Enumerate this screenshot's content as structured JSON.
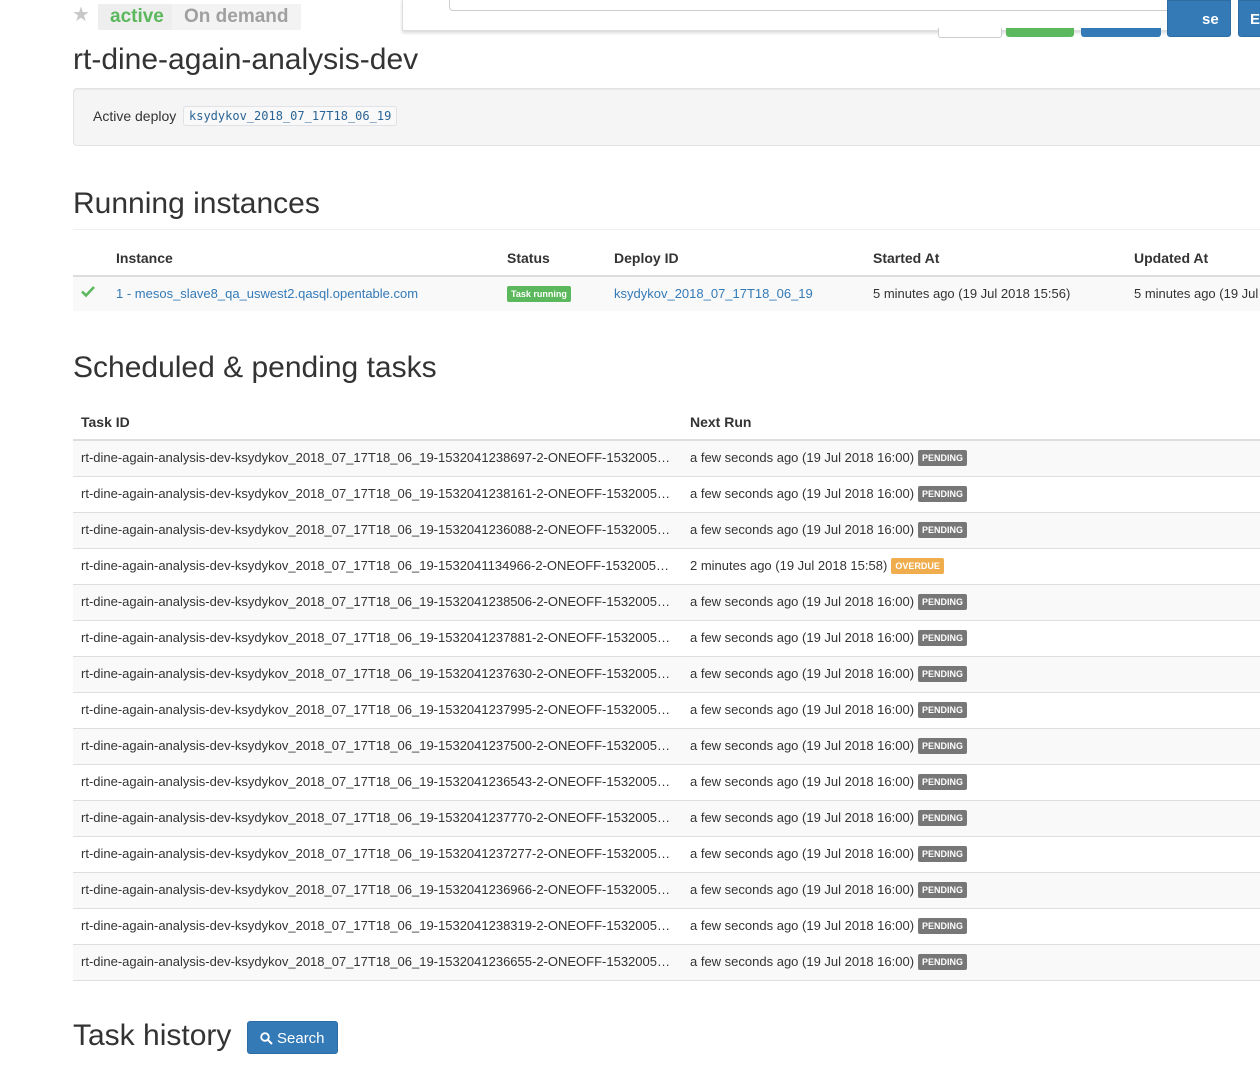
{
  "header": {
    "favorite_icon": "star-icon",
    "state_label": "active",
    "type_label": "On demand",
    "top_buttons": [
      "se",
      "E"
    ]
  },
  "page_title": "rt-dine-again-analysis-dev",
  "active_deploy": {
    "label": "Active deploy",
    "deploy_id": "ksydykov_2018_07_17T18_06_19"
  },
  "running_instances": {
    "title": "Running instances",
    "columns": [
      "Instance",
      "Status",
      "Deploy ID",
      "Started At",
      "Updated At"
    ],
    "rows": [
      {
        "health_icon": "check-icon",
        "instance": "1 - mesos_slave8_qa_uswest2.qasql.opentable.com",
        "status": "Task running",
        "deploy_id": "ksydykov_2018_07_17T18_06_19",
        "started_at": "5 minutes ago (19 Jul 2018 15:56)",
        "updated_at": "5 minutes ago (19 Jul"
      }
    ]
  },
  "scheduled_tasks": {
    "title": "Scheduled & pending tasks",
    "columns": [
      "Task ID",
      "Next Run"
    ],
    "rows": [
      {
        "task_id": "rt-dine-again-analysis-dev-ksydykov_2018_07_17T18_06_19-1532041238697-2-ONEOFF-1532005…",
        "next_run": "a few seconds ago (19 Jul 2018 16:00)",
        "state": "PENDING"
      },
      {
        "task_id": "rt-dine-again-analysis-dev-ksydykov_2018_07_17T18_06_19-1532041238161-2-ONEOFF-1532005…",
        "next_run": "a few seconds ago (19 Jul 2018 16:00)",
        "state": "PENDING"
      },
      {
        "task_id": "rt-dine-again-analysis-dev-ksydykov_2018_07_17T18_06_19-1532041236088-2-ONEOFF-1532005…",
        "next_run": "a few seconds ago (19 Jul 2018 16:00)",
        "state": "PENDING"
      },
      {
        "task_id": "rt-dine-again-analysis-dev-ksydykov_2018_07_17T18_06_19-1532041134966-2-ONEOFF-1532005…",
        "next_run": "2 minutes ago (19 Jul 2018 15:58)",
        "state": "OVERDUE"
      },
      {
        "task_id": "rt-dine-again-analysis-dev-ksydykov_2018_07_17T18_06_19-1532041238506-2-ONEOFF-1532005…",
        "next_run": "a few seconds ago (19 Jul 2018 16:00)",
        "state": "PENDING"
      },
      {
        "task_id": "rt-dine-again-analysis-dev-ksydykov_2018_07_17T18_06_19-1532041237881-2-ONEOFF-1532005…",
        "next_run": "a few seconds ago (19 Jul 2018 16:00)",
        "state": "PENDING"
      },
      {
        "task_id": "rt-dine-again-analysis-dev-ksydykov_2018_07_17T18_06_19-1532041237630-2-ONEOFF-1532005…",
        "next_run": "a few seconds ago (19 Jul 2018 16:00)",
        "state": "PENDING"
      },
      {
        "task_id": "rt-dine-again-analysis-dev-ksydykov_2018_07_17T18_06_19-1532041237995-2-ONEOFF-1532005…",
        "next_run": "a few seconds ago (19 Jul 2018 16:00)",
        "state": "PENDING"
      },
      {
        "task_id": "rt-dine-again-analysis-dev-ksydykov_2018_07_17T18_06_19-1532041237500-2-ONEOFF-1532005…",
        "next_run": "a few seconds ago (19 Jul 2018 16:00)",
        "state": "PENDING"
      },
      {
        "task_id": "rt-dine-again-analysis-dev-ksydykov_2018_07_17T18_06_19-1532041236543-2-ONEOFF-1532005…",
        "next_run": "a few seconds ago (19 Jul 2018 16:00)",
        "state": "PENDING"
      },
      {
        "task_id": "rt-dine-again-analysis-dev-ksydykov_2018_07_17T18_06_19-1532041237770-2-ONEOFF-1532005…",
        "next_run": "a few seconds ago (19 Jul 2018 16:00)",
        "state": "PENDING"
      },
      {
        "task_id": "rt-dine-again-analysis-dev-ksydykov_2018_07_17T18_06_19-1532041237277-2-ONEOFF-1532005…",
        "next_run": "a few seconds ago (19 Jul 2018 16:00)",
        "state": "PENDING"
      },
      {
        "task_id": "rt-dine-again-analysis-dev-ksydykov_2018_07_17T18_06_19-1532041236966-2-ONEOFF-1532005…",
        "next_run": "a few seconds ago (19 Jul 2018 16:00)",
        "state": "PENDING"
      },
      {
        "task_id": "rt-dine-again-analysis-dev-ksydykov_2018_07_17T18_06_19-1532041238319-2-ONEOFF-1532005…",
        "next_run": "a few seconds ago (19 Jul 2018 16:00)",
        "state": "PENDING"
      },
      {
        "task_id": "rt-dine-again-analysis-dev-ksydykov_2018_07_17T18_06_19-1532041236655-2-ONEOFF-1532005…",
        "next_run": "a few seconds ago (19 Jul 2018 16:00)",
        "state": "PENDING"
      }
    ]
  },
  "task_history": {
    "title": "Task history",
    "search_label": "Search",
    "search_icon": "search-icon"
  },
  "colors": {
    "link": "#337ab7",
    "success": "#5cb85c",
    "pending": "#777777",
    "overdue": "#f0ad4e",
    "primary_button": "#337ab7"
  }
}
